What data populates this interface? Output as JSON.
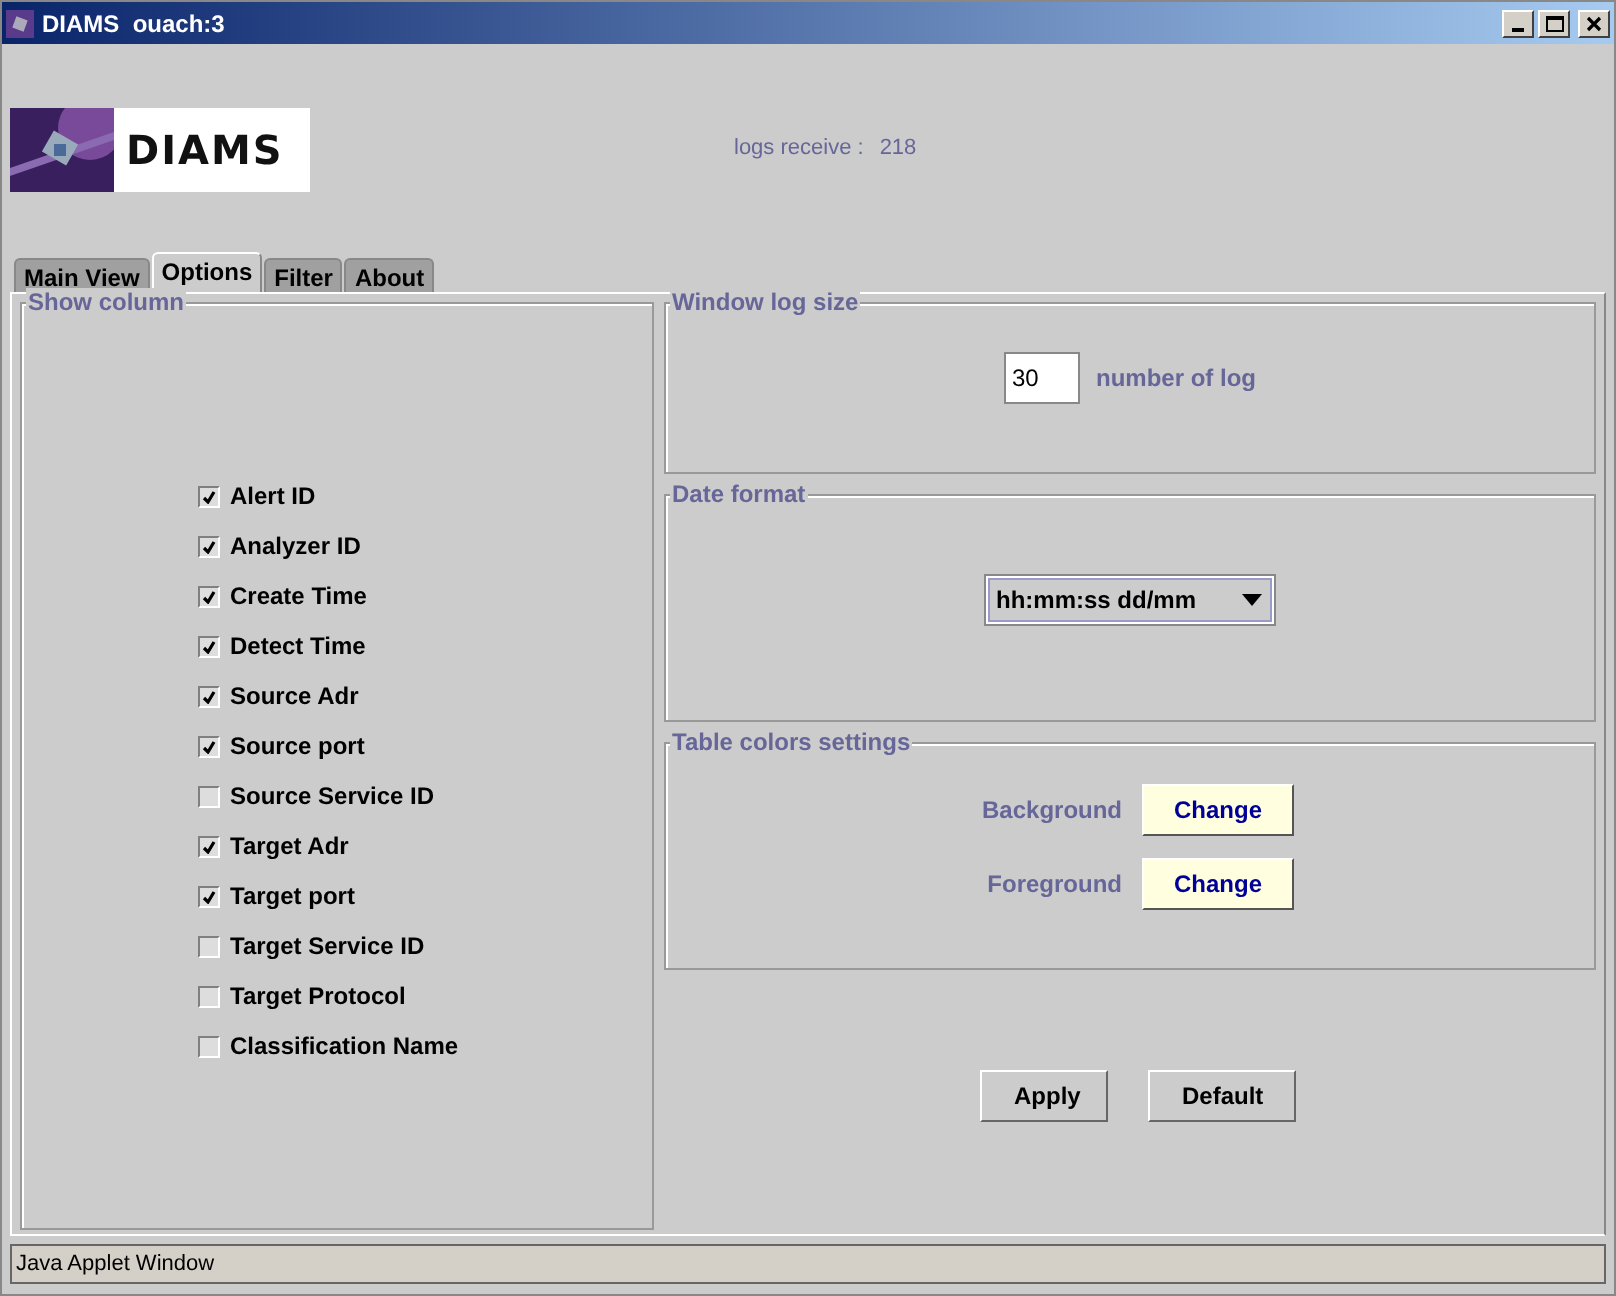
{
  "window": {
    "title": "DIAMS  ouach:3"
  },
  "header": {
    "logo_text": "DIAMS",
    "logs_label": "logs receive :",
    "logs_count": "218"
  },
  "tabs": [
    {
      "label": "Main View",
      "selected": false
    },
    {
      "label": "Options",
      "selected": true
    },
    {
      "label": "Filter",
      "selected": false
    },
    {
      "label": "About",
      "selected": false
    }
  ],
  "show_column": {
    "title": "Show column",
    "items": [
      {
        "label": "Alert ID",
        "checked": true
      },
      {
        "label": "Analyzer ID",
        "checked": true
      },
      {
        "label": "Create Time",
        "checked": true
      },
      {
        "label": "Detect Time",
        "checked": true
      },
      {
        "label": "Source Adr",
        "checked": true
      },
      {
        "label": "Source port",
        "checked": true
      },
      {
        "label": "Source Service ID",
        "checked": false
      },
      {
        "label": "Target Adr",
        "checked": true
      },
      {
        "label": "Target port",
        "checked": true
      },
      {
        "label": "Target Service ID",
        "checked": false
      },
      {
        "label": "Target Protocol",
        "checked": false
      },
      {
        "label": "Classification Name",
        "checked": false
      }
    ]
  },
  "window_log_size": {
    "title": "Window log size",
    "value": "30",
    "label": "number of log"
  },
  "date_format": {
    "title": "Date format",
    "value": "hh:mm:ss dd/mm"
  },
  "table_colors": {
    "title": "Table colors settings",
    "rows": [
      {
        "label": "Background",
        "button": "Change"
      },
      {
        "label": "Foreground",
        "button": "Change"
      }
    ]
  },
  "buttons": [
    "Apply",
    "Default"
  ],
  "status_bar": "Java Applet Window"
}
